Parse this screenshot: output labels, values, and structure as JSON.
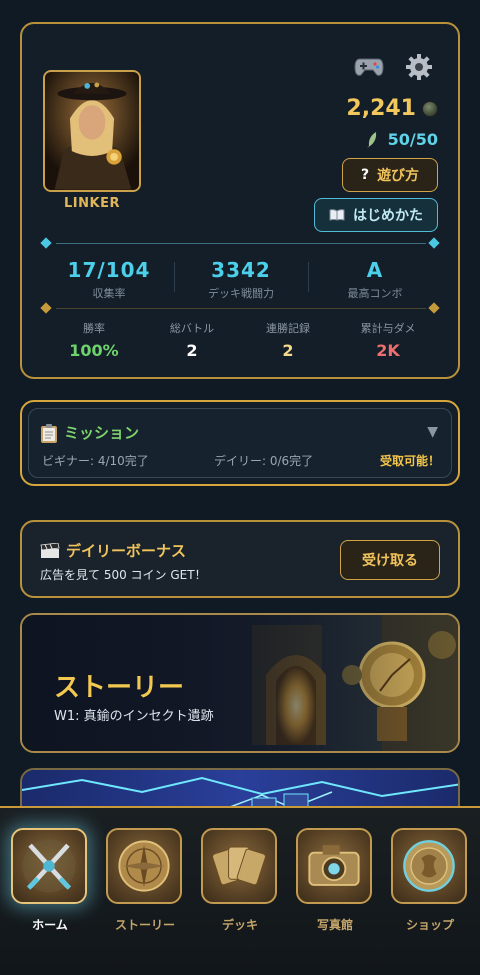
{
  "profile": {
    "name": "LINKER",
    "coins": "2,241",
    "energy": "50/50",
    "howto_label": "遊び方",
    "guide_label": "はじめかた",
    "stats_main": [
      {
        "value": "17/104",
        "label": "収集率"
      },
      {
        "value": "3342",
        "label": "デッキ戦闘力"
      },
      {
        "value": "A",
        "label": "最高コンボ"
      }
    ],
    "stats_sub": [
      {
        "label": "勝率",
        "value": "100%",
        "color": "#6dd36a"
      },
      {
        "label": "総バトル",
        "value": "2",
        "color": "#ffffff"
      },
      {
        "label": "連勝記録",
        "value": "2",
        "color": "#f4d98a"
      },
      {
        "label": "累計与ダメ",
        "value": "2K",
        "color": "#ef6f6f"
      }
    ]
  },
  "mission": {
    "title": "ミッション",
    "beginner": "ビギナー: 4/10完了",
    "daily": "デイリー: 0/6完了",
    "claimable": "受取可能！"
  },
  "daily_bonus": {
    "title": "デイリーボーナス",
    "subtitle": "広告を見て 500 コイン GET！",
    "button": "受け取る"
  },
  "story": {
    "title": "ストーリー",
    "subtitle": "W1: 真鍮のインセクト遺跡"
  },
  "nav": [
    {
      "label": "ホーム",
      "icon": "swords-icon",
      "active": true
    },
    {
      "label": "ストーリー",
      "icon": "compass-icon",
      "active": false
    },
    {
      "label": "デッキ",
      "icon": "cards-icon",
      "active": false
    },
    {
      "label": "写真館",
      "icon": "camera-icon",
      "active": false
    },
    {
      "label": "ショップ",
      "icon": "coin-icon",
      "active": false
    }
  ],
  "colors": {
    "gold": "#d0a448",
    "cyan": "#4cd0ea",
    "background": "#0f1a24"
  }
}
